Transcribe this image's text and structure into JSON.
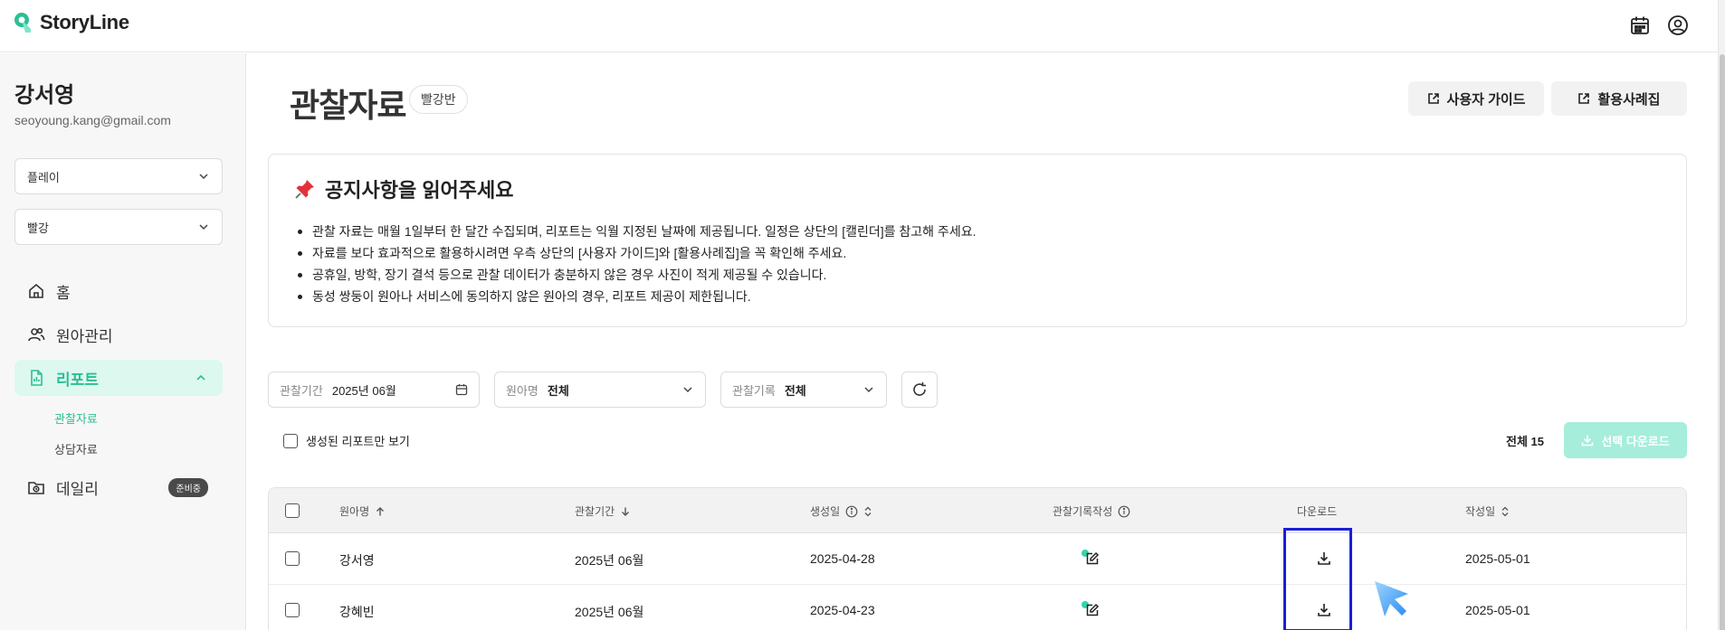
{
  "header": {
    "logo_text": "StoryLine",
    "icons": [
      "calendar-icon",
      "user-circle-icon"
    ],
    "accent": "#2bbf94"
  },
  "sidebar": {
    "user_name": "강서영",
    "user_email": "seoyoung.kang@gmail.com",
    "select_1": "플레이",
    "select_2": "빨강",
    "nav": {
      "home": "홈",
      "children": "원아관리",
      "report": "리포트",
      "sub_observation": "관찰자료",
      "sub_consult": "상담자료",
      "daily": "데일리",
      "daily_badge": "준비중"
    }
  },
  "main": {
    "title": "관찰자료",
    "class_chip": "빨강반",
    "btn_guide": "사용자 가이드",
    "btn_cases": "활용사례집",
    "notice": {
      "title": "공지사항을 읽어주세요",
      "items": [
        "관찰 자료는 매월 1일부터 한 달간 수집되며, 리포트는 익월 지정된 날짜에 제공됩니다. 일정은 상단의 [캘린더]를 참고해 주세요.",
        "자료를 보다 효과적으로 활용하시려면 우측 상단의 [사용자 가이드]와 [활용사례집]을 꼭 확인해 주세요.",
        "공휴일, 방학, 장기 결석 등으로 관찰 데이터가 충분하지 않은 경우 사진이 적게 제공될 수 있습니다.",
        "동성 쌍둥이 원아나 서비스에 동의하지 않은 원아의 경우, 리포트 제공이 제한됩니다."
      ]
    },
    "filters": {
      "period_label": "관찰기간",
      "period_value": "2025년 06월",
      "child_label": "원아명",
      "child_value": "전체",
      "record_label": "관찰기록",
      "record_value": "전체"
    },
    "only_generated": "생성된 리포트만 보기",
    "total": "전체 15",
    "download_selected": "선택 다운로드",
    "table": {
      "headers": {
        "name": "원아명",
        "period": "관찰기간",
        "created": "생성일",
        "record": "관찰기록작성",
        "download": "다운로드",
        "written": "작성일"
      },
      "rows": [
        {
          "name": "강서영",
          "period": "2025년 06월",
          "created": "2025-04-28",
          "written": "2025-05-01"
        },
        {
          "name": "강혜빈",
          "period": "2025년 06월",
          "created": "2025-04-23",
          "written": "2025-05-01"
        }
      ]
    }
  }
}
